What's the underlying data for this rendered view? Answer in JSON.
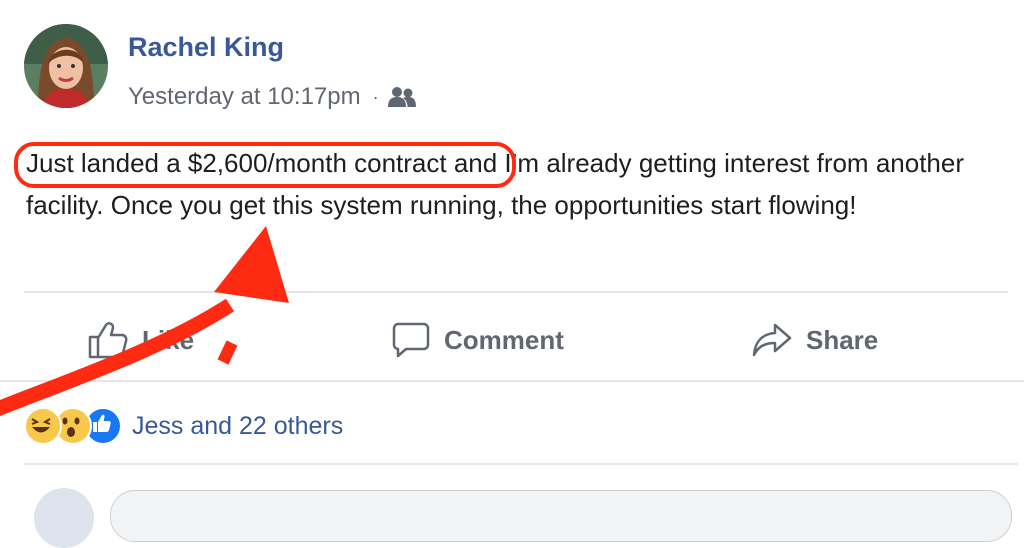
{
  "post": {
    "author_name": "Rachel King",
    "timestamp": "Yesterday at 10:17pm",
    "separator": "·",
    "audience_icon": "friends-icon",
    "text_highlighted": "Just landed a $2,600/month contract",
    "text_rest": " and I’m already getting interest from another facility. Once you get this system running, the opportunities start flowing!"
  },
  "actions": {
    "like_label": "Like",
    "comment_label": "Comment",
    "share_label": "Share"
  },
  "reactions": {
    "icons": [
      "haha-emoji-icon",
      "wow-emoji-icon",
      "like-reaction-icon"
    ],
    "summary": "Jess and 22 others"
  },
  "annotation": {
    "color": "#ff2a12"
  },
  "colors": {
    "author": "#385898",
    "meta": "#616770",
    "body": "#1c1e21",
    "action": "#606770",
    "like_blue": "#1877f2"
  }
}
